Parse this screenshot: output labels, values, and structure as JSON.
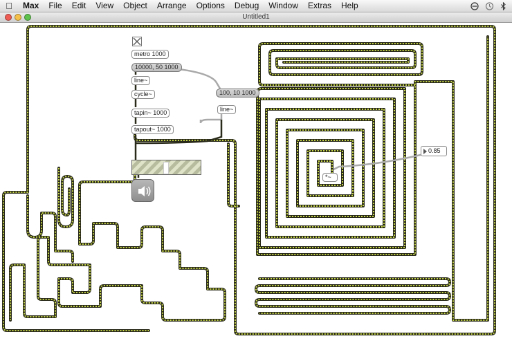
{
  "menubar": {
    "items": [
      "Max",
      "File",
      "Edit",
      "View",
      "Object",
      "Arrange",
      "Options",
      "Debug",
      "Window",
      "Extras",
      "Help"
    ],
    "right_icons": [
      "broadcast-icon",
      "time-machine-icon",
      "bluetooth-icon"
    ]
  },
  "window": {
    "title": "Untitled1",
    "buttons": [
      {
        "name": "close",
        "color": "#ee5c53"
      },
      {
        "name": "minimize",
        "color": "#f5c04a"
      },
      {
        "name": "zoom",
        "color": "#5ec24c"
      }
    ]
  },
  "patch": {
    "metro": "metro 1000",
    "msg_ramp": "10000, 50 1000",
    "line1": "line~",
    "cycle": "cycle~",
    "tapin": "tapin~ 1000",
    "tapout": "tapout~ 1000",
    "msg_ramp2": "100, 10 1000",
    "line2": "line~",
    "number": "0.85",
    "mult": "*~"
  },
  "colors": {
    "cable_dark": "#2a2a1a",
    "cable_dash": "#c8d84a",
    "control_cable": "#a9a9a9"
  }
}
